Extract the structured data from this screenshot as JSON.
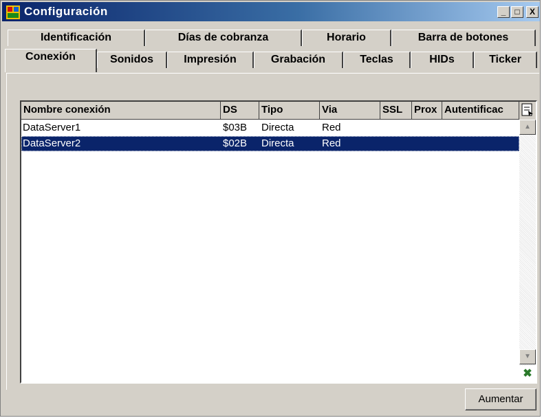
{
  "window": {
    "title": "Configuración"
  },
  "titlebar_buttons": {
    "minimize": "_",
    "maximize": "□",
    "close": "X"
  },
  "tabs_row1": [
    {
      "label": "Identificación"
    },
    {
      "label": "Días de cobranza"
    },
    {
      "label": "Horario"
    },
    {
      "label": "Barra de botones"
    }
  ],
  "tabs_row2": [
    {
      "label": "Conexión",
      "active": true
    },
    {
      "label": "Sonidos"
    },
    {
      "label": "Impresión"
    },
    {
      "label": "Grabación"
    },
    {
      "label": "Teclas"
    },
    {
      "label": "HIDs"
    },
    {
      "label": "Ticker"
    }
  ],
  "table": {
    "columns": [
      "Nombre conexión",
      "DS",
      "Tipo",
      "Via",
      "SSL",
      "Prox",
      "Autentificac"
    ],
    "rows": [
      {
        "name": "DataServer1",
        "ds": "$03B",
        "tipo": "Directa",
        "via": "Red",
        "selected": false
      },
      {
        "name": "DataServer2",
        "ds": "$02B",
        "tipo": "Directa",
        "via": "Red",
        "selected": true
      }
    ]
  },
  "buttons": {
    "aumentar": "Aumentar"
  },
  "colors": {
    "title_bar": "#0a246a",
    "selection": "#0a246a",
    "face": "#d4d0c8"
  }
}
